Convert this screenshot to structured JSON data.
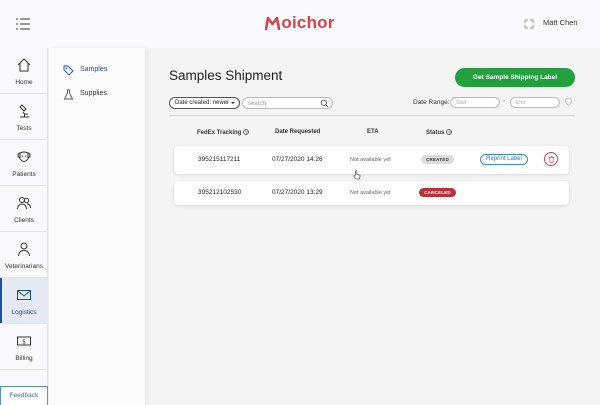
{
  "header": {
    "brand": "oichor",
    "user_name": "Matt Chen"
  },
  "nav": {
    "items": [
      {
        "label": "Home",
        "icon": "home-icon"
      },
      {
        "label": "Tests",
        "icon": "microscope-icon"
      },
      {
        "label": "Patients",
        "icon": "dog-icon"
      },
      {
        "label": "Clients",
        "icon": "users-icon"
      },
      {
        "label": "Veterinarians",
        "icon": "person-icon"
      },
      {
        "label": "Logistics",
        "icon": "mail-icon"
      },
      {
        "label": "Billing",
        "icon": "dollar-bill-icon"
      }
    ],
    "active": "Logistics",
    "feedback_label": "Feedback"
  },
  "subnav": {
    "items": [
      {
        "label": "Samples",
        "icon": "tag-icon"
      },
      {
        "label": "Supplies",
        "icon": "flask-icon"
      }
    ],
    "active": "Samples"
  },
  "main": {
    "title": "Samples Shipment",
    "primary_button": "Get Sample Shipping Label",
    "filter_select": "Date created: newer",
    "search_placeholder": "search",
    "date_range_label": "Date Range:",
    "date_start_placeholder": "Start",
    "date_end_placeholder": "End",
    "date_separator": "-",
    "columns": [
      "FedEx Tracking",
      "Date Requested",
      "ETA",
      "Status"
    ],
    "rows": [
      {
        "tracking": "395215117211",
        "date_requested": "07/27/2020 14:26",
        "eta": "Not available yet",
        "status": "CREATED",
        "action": "Reprint Label"
      },
      {
        "tracking": "395212102530",
        "date_requested": "07/27/2020 13:29",
        "eta": "Not available yet",
        "status": "CANCELED"
      }
    ]
  },
  "colors": {
    "brand": "#d9424a",
    "primary": "#22a03d",
    "active_nav": "#1f4fa0",
    "canceled": "#c0303a"
  }
}
